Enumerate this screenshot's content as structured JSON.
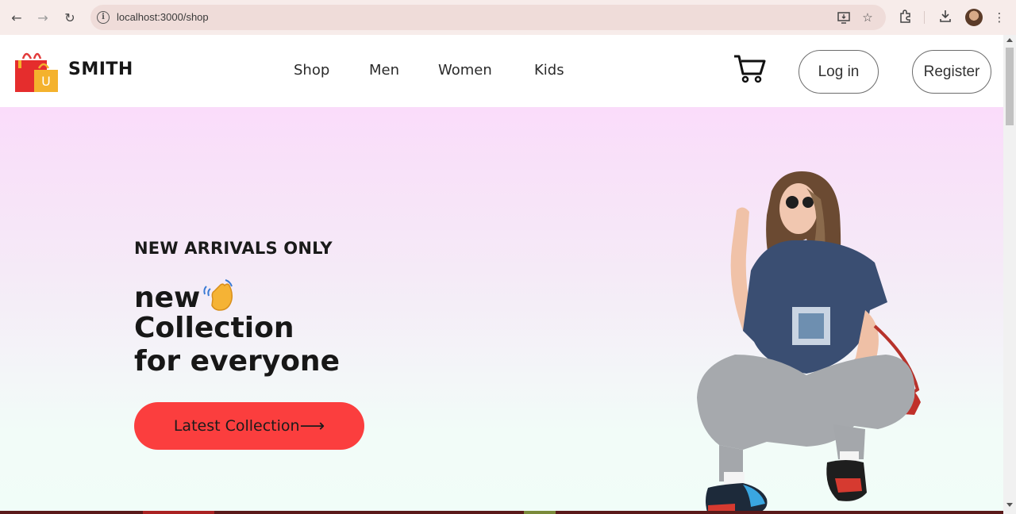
{
  "browser": {
    "url": "localhost:3000/shop",
    "icons": [
      "back-arrow-icon",
      "forward-arrow-icon",
      "reload-icon",
      "site-info-icon",
      "install-app-icon",
      "bookmark-star-icon",
      "extensions-icon",
      "download-icon",
      "profile-avatar",
      "more-menu-icon"
    ]
  },
  "header": {
    "brand": "SMITH",
    "logo_letter": "U",
    "menu": [
      {
        "label": "Shop"
      },
      {
        "label": "Men"
      },
      {
        "label": "Women"
      },
      {
        "label": "Kids"
      }
    ],
    "login_label": "Log in",
    "register_label": "Register"
  },
  "hero": {
    "tagline": "NEW ARRIVALS ONLY",
    "line1": "new",
    "line2": "Collection",
    "line3": "for everyone",
    "cta_label": "Latest Collection",
    "cta_arrow": "⟶"
  },
  "colors": {
    "accent": "#fb3e3e",
    "hero_top": "#fadcfa",
    "hero_bottom": "#f1fdf8"
  }
}
